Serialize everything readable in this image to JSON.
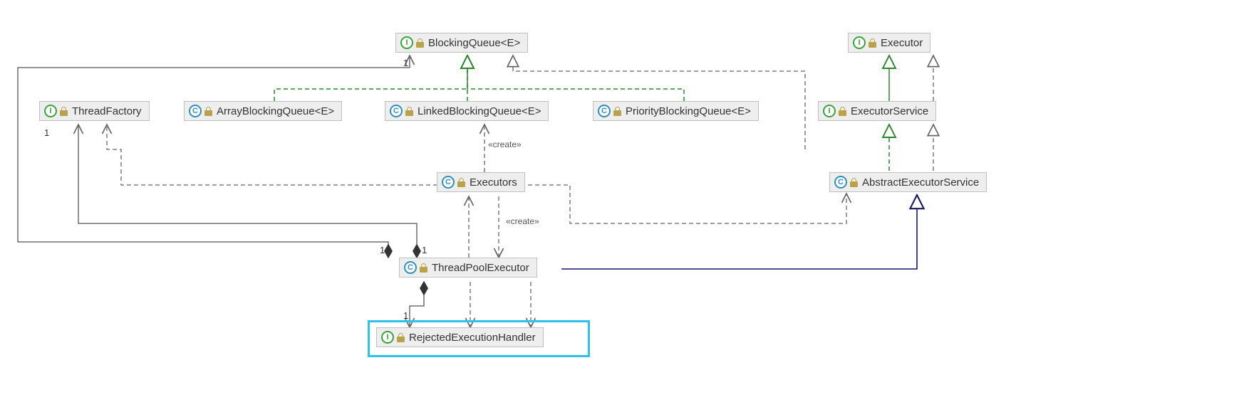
{
  "nodes": {
    "blockingQueue": {
      "label": "BlockingQueue<E>",
      "type": "I"
    },
    "executor": {
      "label": "Executor",
      "type": "I"
    },
    "threadFactory": {
      "label": "ThreadFactory",
      "type": "I"
    },
    "arrayBlockingQueue": {
      "label": "ArrayBlockingQueue<E>",
      "type": "C"
    },
    "linkedBlockingQueue": {
      "label": "LinkedBlockingQueue<E>",
      "type": "C"
    },
    "priorityBlockingQueue": {
      "label": "PriorityBlockingQueue<E>",
      "type": "C"
    },
    "executorService": {
      "label": "ExecutorService",
      "type": "I"
    },
    "executors": {
      "label": "Executors",
      "type": "C"
    },
    "abstractExecutorService": {
      "label": "AbstractExecutorService",
      "type": "C"
    },
    "threadPoolExecutor": {
      "label": "ThreadPoolExecutor",
      "type": "C"
    },
    "rejectedExecutionHandler": {
      "label": "RejectedExecutionHandler",
      "type": "I"
    }
  },
  "edgeLabels": {
    "create1": "«create»",
    "create2": "«create»"
  },
  "multiplicities": {
    "m1": "1",
    "m2": "1",
    "m3": "1",
    "m4": "1",
    "m5": "1"
  }
}
